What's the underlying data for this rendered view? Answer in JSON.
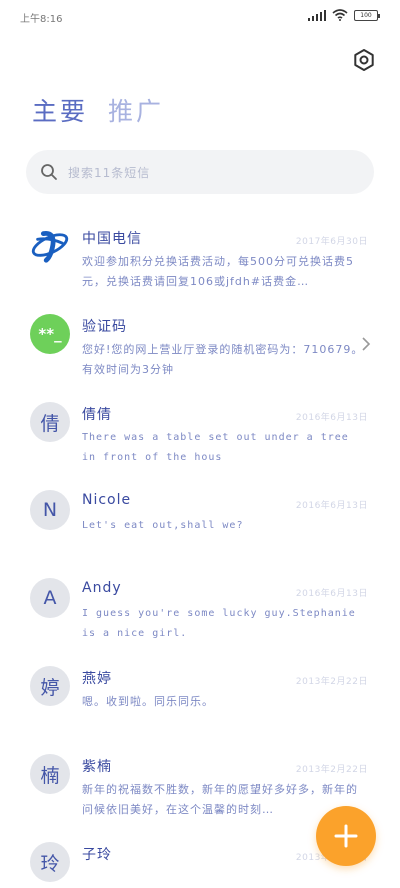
{
  "status": {
    "time": "上午8:16",
    "battery": "100"
  },
  "tabs": {
    "main": "主要",
    "promo": "推广"
  },
  "search": {
    "placeholder": "搜索11条短信"
  },
  "messages": [
    {
      "name": "中国电信",
      "date": "2017年6月30日",
      "preview": "欢迎参加积分兑换话费活动，每500分可兑换话费5元，兑换话费请回复106或jfdh#话费金…",
      "avatar": "logo"
    },
    {
      "name": "验证码",
      "date": "",
      "preview": "您好!您的网上营业厅登录的随机密码为：710679。有效时间为3分钟",
      "avatar": "**_"
    },
    {
      "name": "倩倩",
      "date": "2016年6月13日",
      "preview": "There was a table set out under a tree in front of the hous",
      "avatar": "倩"
    },
    {
      "name": "Nicole",
      "date": "2016年6月13日",
      "preview": "Let's eat out,shall we?",
      "avatar": "N"
    },
    {
      "name": "Andy",
      "date": "2016年6月13日",
      "preview": "I guess you're some lucky guy.Stephanie is a nice girl.",
      "avatar": "A"
    },
    {
      "name": "燕婷",
      "date": "2013年2月22日",
      "preview": "嗯。收到啦。同乐同乐。",
      "avatar": "婷"
    },
    {
      "name": "紫楠",
      "date": "2013年2月22日",
      "preview": "新年的祝福数不胜数，新年的愿望好多好多，新年的问候依旧美好，在这个温馨的时刻…",
      "avatar": "楠"
    },
    {
      "name": "子玲",
      "date": "2013年2月22日",
      "preview": "",
      "avatar": "玲"
    }
  ],
  "colors": {
    "accent": "#5a6cc2",
    "fab": "#fba22b",
    "verify_avatar": "#6ed05a"
  }
}
